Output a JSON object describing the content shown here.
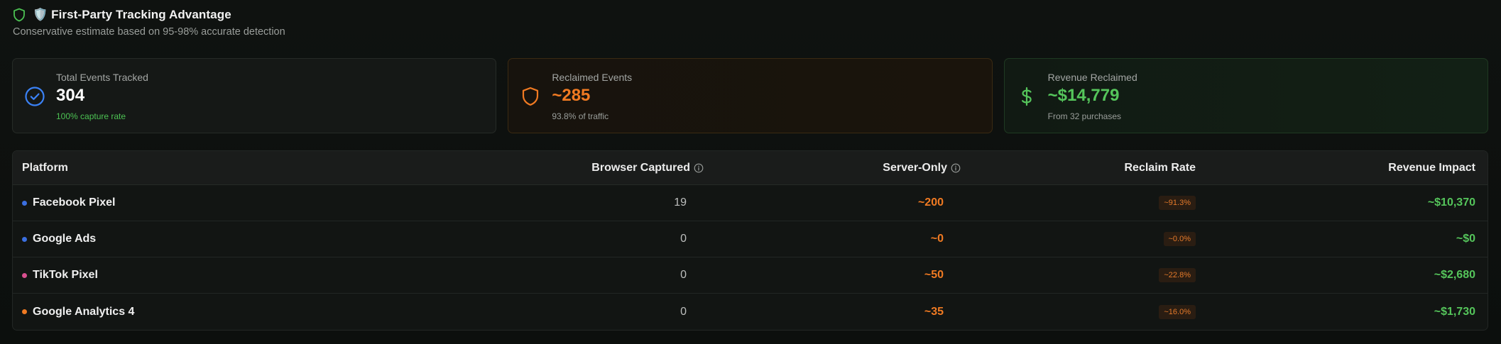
{
  "header": {
    "title": "🛡️ First-Party Tracking Advantage",
    "subtitle": "Conservative estimate based on 95-98% accurate detection"
  },
  "cards": [
    {
      "label": "Total Events Tracked",
      "value": "304",
      "note": "100% capture rate",
      "icon": "check-circle-icon",
      "accent": "#3b82f6"
    },
    {
      "label": "Reclaimed Events",
      "value": "~285",
      "note": "93.8% of traffic",
      "icon": "shield-icon",
      "accent": "#f07a22"
    },
    {
      "label": "Revenue Reclaimed",
      "value": "~$14,779",
      "note": "From 32 purchases",
      "icon": "dollar-icon",
      "accent": "#55c55b"
    }
  ],
  "table": {
    "headers": {
      "platform": "Platform",
      "browser": "Browser Captured",
      "server": "Server-Only",
      "rate": "Reclaim Rate",
      "revenue": "Revenue Impact"
    },
    "rows": [
      {
        "platform": "Facebook Pixel",
        "dot_color": "#3b6fe0",
        "browser": "19",
        "server": "~200",
        "rate": "~91.3%",
        "revenue": "~$10,370"
      },
      {
        "platform": "Google Ads",
        "dot_color": "#3b6fe0",
        "browser": "0",
        "server": "~0",
        "rate": "~0.0%",
        "revenue": "~$0"
      },
      {
        "platform": "TikTok Pixel",
        "dot_color": "#d94f8f",
        "browser": "0",
        "server": "~50",
        "rate": "~22.8%",
        "revenue": "~$2,680"
      },
      {
        "platform": "Google Analytics 4",
        "dot_color": "#f07a22",
        "browser": "0",
        "server": "~35",
        "rate": "~16.0%",
        "revenue": "~$1,730"
      }
    ]
  },
  "colors": {
    "orange": "#f07a22",
    "green": "#55c55b",
    "blue": "#3b82f6"
  }
}
